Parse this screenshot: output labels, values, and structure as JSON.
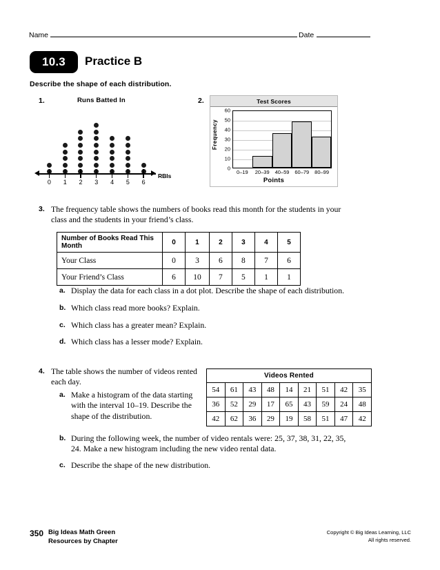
{
  "header": {
    "name_label": "Name",
    "date_label": "Date",
    "lesson_number": "10.3",
    "practice_title": "Practice B",
    "directions": "Describe the shape of each distribution."
  },
  "problem1": {
    "number": "1.",
    "chart_data": {
      "type": "dot-plot",
      "title": "Runs Batted In",
      "xlabel": "RBIs",
      "ylabel": "",
      "categories": [
        "0",
        "1",
        "2",
        "3",
        "4",
        "5",
        "6"
      ],
      "values": [
        2,
        5,
        7,
        8,
        6,
        6,
        2
      ],
      "axis_arrows": "both",
      "grid": false
    }
  },
  "problem2": {
    "number": "2.",
    "chart_data": {
      "type": "bar",
      "title": "Test Scores",
      "xlabel": "Points",
      "ylabel": "Frequency",
      "categories": [
        "0–19",
        "20–39",
        "40–59",
        "60–79",
        "80–99"
      ],
      "values": [
        0,
        12,
        36,
        48,
        32
      ],
      "ylim": [
        0,
        60
      ],
      "yticks": [
        0,
        10,
        20,
        30,
        40,
        50,
        60
      ],
      "grid": true,
      "bar_color": "#d3d3d3"
    }
  },
  "problem3": {
    "number": "3.",
    "text": "The frequency table shows the numbers of books read this month for the students in your class and the students in your friend’s class.",
    "table": {
      "header_label": "Number of Books Read This Month",
      "columns": [
        "0",
        "1",
        "2",
        "3",
        "4",
        "5"
      ],
      "rows": [
        {
          "label": "Your Class",
          "values": [
            "0",
            "3",
            "6",
            "8",
            "7",
            "6"
          ]
        },
        {
          "label": "Your Friend’s Class",
          "values": [
            "6",
            "10",
            "7",
            "5",
            "1",
            "1"
          ]
        }
      ]
    },
    "parts": [
      {
        "letter": "a.",
        "text": "Display the data for each class in a dot plot. Describe the shape of each distribution."
      },
      {
        "letter": "b.",
        "text": "Which class read more books? Explain."
      },
      {
        "letter": "c.",
        "text": "Which class has a greater mean? Explain."
      },
      {
        "letter": "d.",
        "text": "Which class has a lesser mode? Explain."
      }
    ]
  },
  "problem4": {
    "number": "4.",
    "text": "The table shows the number of videos rented each day.",
    "part_a": {
      "letter": "a.",
      "text": "Make a histogram of the data starting with the interval 10–19. Describe the shape of the distribution."
    },
    "part_b": {
      "letter": "b.",
      "text": "During the following week, the number of video rentals were: 25, 37, 38, 31, 22, 35, 24. Make a new histogram including the new video rental data."
    },
    "part_c": {
      "letter": "c.",
      "text": "Describe the shape of the new distribution."
    },
    "table": {
      "title": "Videos Rented",
      "rows": [
        [
          "54",
          "61",
          "43",
          "48",
          "14",
          "21",
          "51",
          "42",
          "35"
        ],
        [
          "36",
          "52",
          "29",
          "17",
          "65",
          "43",
          "59",
          "24",
          "48"
        ],
        [
          "42",
          "62",
          "36",
          "29",
          "19",
          "58",
          "51",
          "47",
          "42"
        ]
      ]
    }
  },
  "footer": {
    "page_number": "350",
    "book_title": "Big Ideas Math Green",
    "book_subtitle": "Resources by Chapter",
    "copyright": "Copyright © Big Ideas Learning, LLC",
    "rights": "All rights reserved."
  }
}
